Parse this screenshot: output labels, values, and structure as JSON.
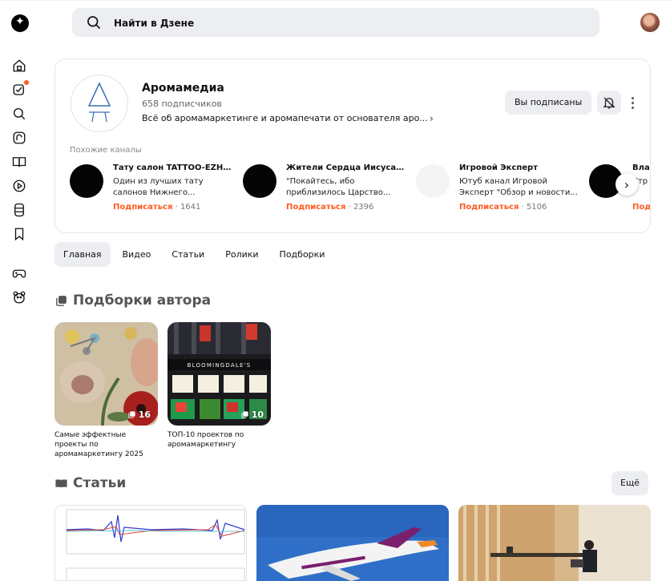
{
  "search": {
    "placeholder": "Найти в Дзене"
  },
  "channel": {
    "name": "Аромамедиа",
    "subscribers": "658 подписчиков",
    "description": "Всё об аромамаркетинге и аромапечати от основателя аро...",
    "subscribed_label": "Вы подписаны"
  },
  "similar": {
    "title": "Похожие каналы",
    "items": [
      {
        "name": "Тату салон TATTOO-EZH Н...",
        "desc": "Один из лучших тату салонов Нижнего...",
        "action": "Подписаться",
        "sep": "·",
        "count": "1641"
      },
      {
        "name": "Жители Сердца Иисуса (...",
        "desc": "\"Покайтесь, ибо приблизилось Царство...",
        "action": "Подписаться",
        "sep": "·",
        "count": "2396"
      },
      {
        "name": "Игровой Эксперт",
        "desc": "Ютуб канал Игровой Эксперт \"Обзор и новости...",
        "action": "Подписаться",
        "sep": "·",
        "count": "5106"
      },
      {
        "name": "Вла",
        "desc": "Стр Гос",
        "action": "Под",
        "sep": "",
        "count": ""
      }
    ]
  },
  "tabs": [
    {
      "label": "Главная",
      "active": true
    },
    {
      "label": "Видео",
      "active": false
    },
    {
      "label": "Статьи",
      "active": false
    },
    {
      "label": "Ролики",
      "active": false
    },
    {
      "label": "Подборки",
      "active": false
    }
  ],
  "collections": {
    "title": "Подборки автора",
    "items": [
      {
        "title": "Самые эффектные проекты по аромамаркетингу 2025",
        "count": "16"
      },
      {
        "title": "ТОП-10 проектов по аромамаркетингу",
        "count": "10",
        "sign": "BLOOMINGDALE'S"
      }
    ]
  },
  "articles": {
    "title": "Статьи",
    "more_label": "Ещё"
  },
  "colors": {
    "accent": "#ff5a1f",
    "chip": "#eceef2"
  }
}
